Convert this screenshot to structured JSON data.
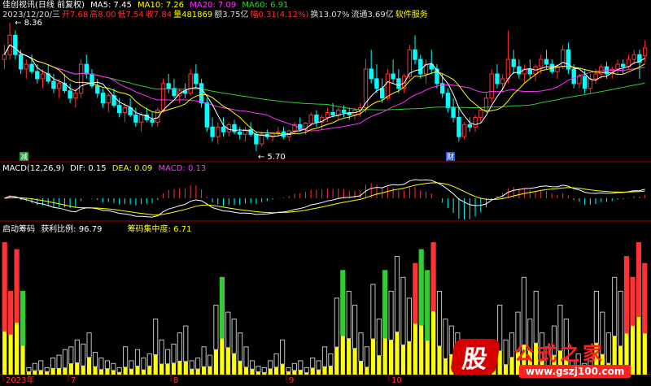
{
  "main_panel": {
    "title": "佳创视讯(日线 前复权)",
    "ma_labels": [
      {
        "text": "MA5: 7.45",
        "color": "#ffffff"
      },
      {
        "text": "MA10: 7.26",
        "color": "#ffff00"
      },
      {
        "text": "MA20: 7.09",
        "color": "#ff33ff"
      },
      {
        "text": "MA60: 6.91",
        "color": "#33cc33"
      }
    ],
    "quote_line": [
      {
        "text": "2023/12/20/三",
        "color": "#dddddd"
      },
      {
        "text": "开7.68",
        "color": "#ff3333"
      },
      {
        "text": "高8.00",
        "color": "#ff3333"
      },
      {
        "text": "低7.54",
        "color": "#ff3333"
      },
      {
        "text": "收7.84",
        "color": "#ff3333"
      },
      {
        "text": "量481869",
        "color": "#ffff00"
      },
      {
        "text": "额3.75亿",
        "color": "#dddddd"
      },
      {
        "text": "幅0.31(4.12%)",
        "color": "#ff3333"
      },
      {
        "text": "换13.07%",
        "color": "#dddddd"
      },
      {
        "text": "流通3.69亿",
        "color": "#dddddd"
      },
      {
        "text": "软件服务",
        "color": "#ffff00"
      }
    ],
    "high_marker": "8.36",
    "low_marker": "5.70",
    "event_badges": [
      "减",
      "财"
    ]
  },
  "macd_panel": {
    "title": "MACD(12,26,9)",
    "labels": [
      {
        "text": "DIF: 0.15",
        "color": "#ffffff"
      },
      {
        "text": "DEA: 0.09",
        "color": "#ffff00"
      },
      {
        "text": "MACD: 0.13",
        "color": "#ff33ff"
      }
    ]
  },
  "chip_panel": {
    "title": "启动筹码",
    "labels": [
      {
        "text": "获利比例: 96.79",
        "color": "#ffffff"
      },
      {
        "text": "筹码集中度: 6.71",
        "color": "#ffff00"
      }
    ]
  },
  "x_axis": {
    "labels": [
      "2023年",
      "7",
      "8",
      "9",
      "10"
    ]
  },
  "watermark": {
    "logo_char": "股",
    "text": "公式之家",
    "url": "www.gszj100.com"
  },
  "colors": {
    "up": "#ff3333",
    "down": "#00ffff",
    "ma5": "#ffffff",
    "ma10": "#ffff00",
    "ma20": "#ff33ff",
    "ma60": "#33cc33",
    "divider": "#aa0000",
    "chip_yellow": "#ffff00",
    "chip_grey": "#c0c0c0",
    "chip_green": "#33cc33",
    "chip_red": "#ff3333"
  },
  "chart_data": {
    "type": "candlestick",
    "price_range": [
      5.7,
      8.36
    ],
    "candles": [
      [
        7.6,
        7.9,
        7.4,
        7.7
      ],
      [
        7.7,
        8.36,
        7.6,
        8.1
      ],
      [
        8.1,
        8.2,
        7.6,
        7.7
      ],
      [
        7.7,
        7.8,
        7.3,
        7.4
      ],
      [
        7.4,
        7.6,
        7.2,
        7.5
      ],
      [
        7.5,
        7.7,
        7.3,
        7.35
      ],
      [
        7.35,
        7.5,
        7.1,
        7.2
      ],
      [
        7.2,
        7.4,
        7.0,
        7.3
      ],
      [
        7.3,
        7.5,
        7.1,
        7.15
      ],
      [
        7.15,
        7.3,
        6.9,
        7.0
      ],
      [
        7.0,
        7.2,
        6.8,
        7.1
      ],
      [
        7.1,
        7.3,
        6.9,
        6.95
      ],
      [
        6.95,
        7.1,
        6.7,
        6.8
      ],
      [
        6.8,
        7.0,
        6.6,
        6.9
      ],
      [
        6.9,
        7.6,
        6.8,
        7.5
      ],
      [
        7.5,
        7.7,
        7.2,
        7.3
      ],
      [
        7.3,
        7.4,
        7.0,
        7.05
      ],
      [
        7.05,
        7.2,
        6.8,
        6.9
      ],
      [
        6.9,
        7.0,
        6.6,
        6.7
      ],
      [
        6.7,
        6.9,
        6.5,
        6.85
      ],
      [
        6.85,
        7.0,
        6.6,
        6.65
      ],
      [
        6.65,
        6.8,
        6.4,
        6.5
      ],
      [
        6.5,
        6.7,
        6.3,
        6.6
      ],
      [
        6.6,
        6.8,
        6.4,
        6.45
      ],
      [
        6.45,
        6.6,
        6.2,
        6.3
      ],
      [
        6.3,
        6.5,
        6.1,
        6.45
      ],
      [
        6.45,
        6.6,
        6.3,
        6.35
      ],
      [
        6.35,
        6.5,
        6.2,
        6.3
      ],
      [
        6.3,
        6.6,
        6.2,
        6.55
      ],
      [
        6.55,
        7.2,
        6.5,
        7.1
      ],
      [
        7.1,
        7.3,
        6.9,
        7.0
      ],
      [
        7.0,
        7.2,
        6.8,
        6.85
      ],
      [
        6.85,
        7.0,
        6.7,
        6.95
      ],
      [
        6.95,
        7.1,
        6.8,
        6.9
      ],
      [
        6.9,
        7.4,
        6.85,
        7.3
      ],
      [
        7.3,
        7.5,
        7.0,
        7.1
      ],
      [
        7.1,
        7.2,
        6.6,
        6.7
      ],
      [
        6.7,
        6.8,
        6.1,
        6.2
      ],
      [
        6.2,
        6.4,
        5.9,
        6.0
      ],
      [
        6.0,
        6.3,
        5.85,
        6.2
      ],
      [
        6.2,
        6.4,
        6.0,
        6.1
      ],
      [
        6.1,
        6.3,
        6.0,
        6.25
      ],
      [
        6.25,
        6.35,
        6.05,
        6.1
      ],
      [
        6.1,
        6.2,
        5.95,
        6.05
      ],
      [
        6.05,
        6.2,
        5.9,
        6.15
      ],
      [
        6.15,
        6.3,
        6.0,
        6.05
      ],
      [
        6.05,
        6.1,
        5.7,
        5.85
      ],
      [
        5.85,
        6.1,
        5.8,
        6.05
      ],
      [
        6.05,
        6.15,
        5.95,
        6.0
      ],
      [
        6.0,
        6.1,
        5.9,
        6.08
      ],
      [
        6.08,
        6.2,
        6.0,
        6.1
      ],
      [
        6.1,
        6.2,
        5.95,
        6.0
      ],
      [
        6.0,
        6.15,
        5.9,
        6.12
      ],
      [
        6.12,
        6.3,
        6.05,
        6.25
      ],
      [
        6.25,
        6.4,
        6.1,
        6.15
      ],
      [
        6.15,
        6.3,
        6.05,
        6.28
      ],
      [
        6.28,
        6.5,
        6.2,
        6.45
      ],
      [
        6.45,
        6.55,
        6.2,
        6.3
      ],
      [
        6.3,
        6.45,
        6.15,
        6.4
      ],
      [
        6.4,
        6.6,
        6.3,
        6.5
      ],
      [
        6.5,
        6.7,
        6.4,
        6.45
      ],
      [
        6.45,
        6.6,
        6.35,
        6.55
      ],
      [
        6.55,
        6.65,
        6.4,
        6.5
      ],
      [
        6.5,
        6.6,
        6.35,
        6.45
      ],
      [
        6.45,
        6.6,
        6.35,
        6.55
      ],
      [
        6.55,
        6.7,
        6.4,
        6.6
      ],
      [
        6.6,
        7.6,
        6.5,
        7.4
      ],
      [
        7.4,
        7.8,
        7.1,
        7.2
      ],
      [
        7.2,
        7.5,
        6.9,
        7.0
      ],
      [
        7.0,
        7.2,
        6.7,
        6.8
      ],
      [
        6.8,
        7.4,
        6.75,
        7.3
      ],
      [
        7.3,
        7.6,
        7.1,
        7.2
      ],
      [
        7.2,
        7.4,
        6.9,
        7.0
      ],
      [
        7.0,
        7.3,
        6.9,
        7.25
      ],
      [
        7.25,
        7.9,
        7.2,
        7.8
      ],
      [
        7.8,
        8.1,
        7.5,
        7.6
      ],
      [
        7.6,
        7.7,
        7.2,
        7.3
      ],
      [
        7.3,
        7.6,
        7.1,
        7.5
      ],
      [
        7.5,
        7.8,
        7.3,
        7.4
      ],
      [
        7.4,
        7.5,
        7.0,
        7.1
      ],
      [
        7.1,
        7.3,
        6.8,
        6.9
      ],
      [
        6.9,
        7.0,
        6.5,
        6.6
      ],
      [
        6.6,
        6.8,
        6.3,
        6.4
      ],
      [
        6.4,
        6.6,
        5.9,
        6.0
      ],
      [
        6.0,
        6.3,
        5.95,
        6.25
      ],
      [
        6.25,
        6.4,
        6.1,
        6.2
      ],
      [
        6.2,
        6.45,
        6.1,
        6.4
      ],
      [
        6.4,
        6.6,
        6.3,
        6.55
      ],
      [
        6.55,
        6.9,
        6.5,
        6.8
      ],
      [
        6.8,
        7.4,
        6.7,
        7.3
      ],
      [
        7.3,
        7.5,
        7.0,
        7.1
      ],
      [
        7.1,
        7.3,
        6.9,
        7.2
      ],
      [
        7.2,
        8.2,
        7.1,
        7.6
      ],
      [
        7.6,
        7.8,
        7.3,
        7.45
      ],
      [
        7.45,
        7.6,
        7.2,
        7.3
      ],
      [
        7.3,
        7.5,
        7.1,
        7.4
      ],
      [
        7.4,
        7.6,
        7.2,
        7.3
      ],
      [
        7.3,
        7.5,
        7.15,
        7.45
      ],
      [
        7.45,
        7.7,
        7.3,
        7.6
      ],
      [
        7.6,
        7.8,
        7.4,
        7.5
      ],
      [
        7.5,
        7.6,
        7.3,
        7.35
      ],
      [
        7.35,
        7.5,
        7.2,
        7.45
      ],
      [
        7.45,
        7.9,
        7.4,
        7.8
      ],
      [
        7.8,
        7.95,
        7.3,
        7.4
      ],
      [
        7.4,
        7.5,
        7.0,
        7.1
      ],
      [
        7.1,
        7.3,
        7.0,
        7.25
      ],
      [
        7.25,
        7.4,
        6.9,
        7.0
      ],
      [
        7.0,
        7.3,
        6.9,
        7.2
      ],
      [
        7.2,
        7.4,
        7.1,
        7.3
      ],
      [
        7.3,
        7.5,
        7.2,
        7.45
      ],
      [
        7.45,
        7.55,
        7.2,
        7.3
      ],
      [
        7.3,
        7.45,
        7.2,
        7.4
      ],
      [
        7.4,
        7.6,
        7.3,
        7.5
      ],
      [
        7.5,
        7.6,
        7.3,
        7.45
      ],
      [
        7.45,
        7.7,
        7.4,
        7.6
      ],
      [
        7.6,
        7.8,
        7.5,
        7.7
      ],
      [
        7.7,
        7.8,
        7.2,
        7.54
      ],
      [
        7.68,
        8.0,
        7.54,
        7.84
      ]
    ],
    "chip_bars": [
      [
        0.95,
        "red"
      ],
      [
        0.6,
        "red"
      ],
      [
        0.9,
        "red"
      ],
      [
        0.6,
        "green"
      ],
      [
        0.05,
        "grey"
      ],
      [
        0.08,
        "grey"
      ],
      [
        0.1,
        "grey"
      ],
      [
        0.05,
        "grey"
      ],
      [
        0.12,
        "grey"
      ],
      [
        0.14,
        "grey"
      ],
      [
        0.18,
        "grey"
      ],
      [
        0.2,
        "grey"
      ],
      [
        0.25,
        "grey"
      ],
      [
        0.22,
        "grey"
      ],
      [
        0.3,
        "grey"
      ],
      [
        0.16,
        "grey"
      ],
      [
        0.12,
        "grey"
      ],
      [
        0.1,
        "grey"
      ],
      [
        0.08,
        "grey"
      ],
      [
        0.05,
        "grey"
      ],
      [
        0.2,
        "grey"
      ],
      [
        0.1,
        "grey"
      ],
      [
        0.18,
        "grey"
      ],
      [
        0.12,
        "grey"
      ],
      [
        0.15,
        "grey"
      ],
      [
        0.4,
        "grey"
      ],
      [
        0.25,
        "grey"
      ],
      [
        0.18,
        "grey"
      ],
      [
        0.22,
        "grey"
      ],
      [
        0.3,
        "grey"
      ],
      [
        0.35,
        "grey"
      ],
      [
        0.1,
        "grey"
      ],
      [
        0.12,
        "grey"
      ],
      [
        0.2,
        "grey"
      ],
      [
        0.14,
        "grey"
      ],
      [
        0.5,
        "grey"
      ],
      [
        0.7,
        "green"
      ],
      [
        0.45,
        "grey"
      ],
      [
        0.4,
        "grey"
      ],
      [
        0.3,
        "grey"
      ],
      [
        0.2,
        "grey"
      ],
      [
        0.1,
        "grey"
      ],
      [
        0.06,
        "grey"
      ],
      [
        0.05,
        "grey"
      ],
      [
        0.1,
        "grey"
      ],
      [
        0.15,
        "grey"
      ],
      [
        0.25,
        "grey"
      ],
      [
        0.05,
        "grey"
      ],
      [
        0.08,
        "grey"
      ],
      [
        0.1,
        "grey"
      ],
      [
        0.05,
        "grey"
      ],
      [
        0.12,
        "grey"
      ],
      [
        0.1,
        "grey"
      ],
      [
        0.2,
        "grey"
      ],
      [
        0.15,
        "grey"
      ],
      [
        0.55,
        "grey"
      ],
      [
        0.75,
        "green"
      ],
      [
        0.6,
        "grey"
      ],
      [
        0.5,
        "grey"
      ],
      [
        0.3,
        "grey"
      ],
      [
        0.2,
        "grey"
      ],
      [
        0.65,
        "grey"
      ],
      [
        0.4,
        "grey"
      ],
      [
        0.75,
        "green"
      ],
      [
        0.6,
        "grey"
      ],
      [
        0.85,
        "grey"
      ],
      [
        0.7,
        "grey"
      ],
      [
        0.55,
        "grey"
      ],
      [
        0.8,
        "red"
      ],
      [
        0.9,
        "green"
      ],
      [
        0.75,
        "green"
      ],
      [
        0.95,
        "red"
      ],
      [
        0.6,
        "grey"
      ],
      [
        0.4,
        "grey"
      ],
      [
        0.35,
        "grey"
      ],
      [
        0.3,
        "grey"
      ],
      [
        0.2,
        "grey"
      ],
      [
        0.1,
        "grey"
      ],
      [
        0.08,
        "grey"
      ],
      [
        0.12,
        "grey"
      ],
      [
        0.05,
        "grey"
      ],
      [
        0.1,
        "grey"
      ],
      [
        0.5,
        "grey"
      ],
      [
        0.25,
        "grey"
      ],
      [
        0.3,
        "grey"
      ],
      [
        0.45,
        "grey"
      ],
      [
        0.7,
        "grey"
      ],
      [
        0.4,
        "grey"
      ],
      [
        0.6,
        "grey"
      ],
      [
        0.3,
        "grey"
      ],
      [
        0.2,
        "grey"
      ],
      [
        0.35,
        "grey"
      ],
      [
        0.5,
        "grey"
      ],
      [
        0.4,
        "grey"
      ],
      [
        0.1,
        "grey"
      ],
      [
        0.15,
        "grey"
      ],
      [
        0.08,
        "grey"
      ],
      [
        0.12,
        "grey"
      ],
      [
        0.6,
        "grey"
      ],
      [
        0.45,
        "grey"
      ],
      [
        0.3,
        "grey"
      ],
      [
        0.7,
        "grey"
      ],
      [
        0.6,
        "grey"
      ],
      [
        0.85,
        "red"
      ],
      [
        0.7,
        "red"
      ],
      [
        0.95,
        "red"
      ],
      [
        0.8,
        "red"
      ]
    ]
  }
}
